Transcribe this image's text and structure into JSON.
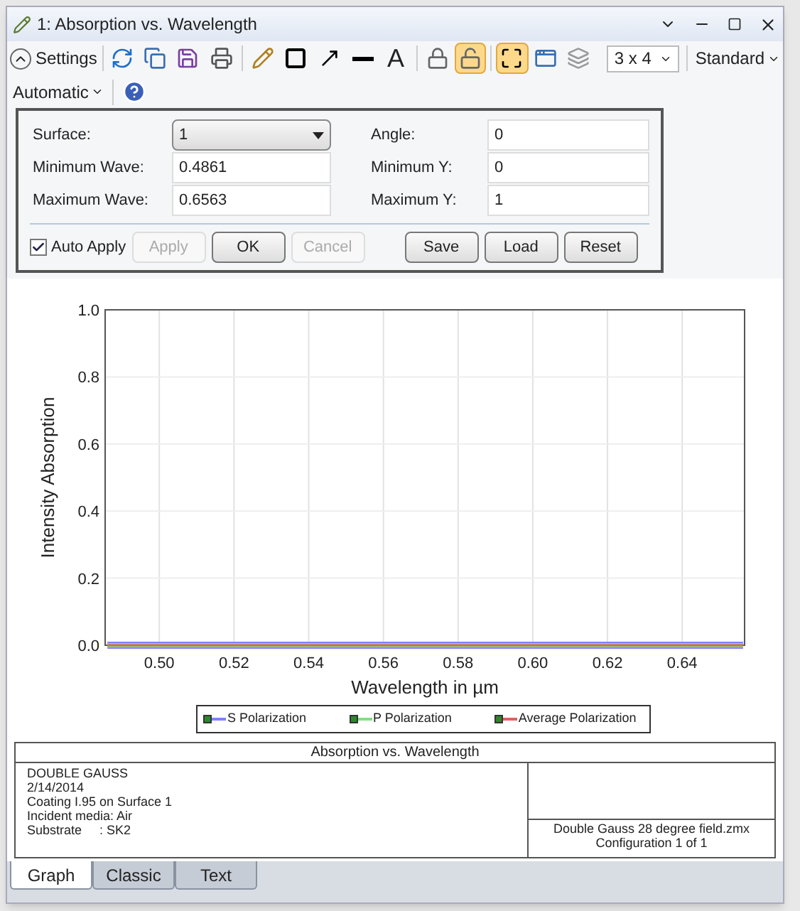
{
  "window": {
    "title": "1: Absorption vs. Wavelength"
  },
  "toolbar": {
    "settings_label": "Settings",
    "settings_expanded": true,
    "tools": [
      {
        "kind": "refresh",
        "selected": false
      },
      {
        "kind": "copy",
        "selected": false
      },
      {
        "kind": "save",
        "selected": false
      },
      {
        "kind": "print",
        "selected": false
      },
      {
        "kind": "pencil",
        "selected": false
      },
      {
        "kind": "rectangle",
        "selected": false
      },
      {
        "kind": "arrow",
        "selected": false
      },
      {
        "kind": "line",
        "selected": false
      },
      {
        "kind": "text",
        "label": "A",
        "selected": false
      },
      {
        "kind": "lock",
        "selected": false
      },
      {
        "kind": "unlock",
        "selected": true
      },
      {
        "kind": "fit",
        "selected": true
      },
      {
        "kind": "windows",
        "selected": false
      },
      {
        "kind": "layers",
        "selected": false
      }
    ],
    "layout_select": "3 x 4",
    "style_menu": "Standard",
    "scale_menu": "Automatic"
  },
  "settings": {
    "fields": [
      {
        "label": "Surface:",
        "value": "1",
        "kind": "dropdown"
      },
      {
        "label": "Angle:",
        "value": "0",
        "kind": "input"
      },
      {
        "label": "Minimum Wave:",
        "value": "0.4861",
        "kind": "input"
      },
      {
        "label": "Minimum Y:",
        "value": "0",
        "kind": "input"
      },
      {
        "label": "Maximum Wave:",
        "value": "0.6563",
        "kind": "input"
      },
      {
        "label": "Maximum Y:",
        "value": "1",
        "kind": "input"
      }
    ],
    "auto_apply": {
      "label": "Auto Apply",
      "checked": true
    },
    "buttons": [
      {
        "label": "Apply",
        "disabled": true
      },
      {
        "label": "OK",
        "disabled": false
      },
      {
        "label": "Cancel",
        "disabled": true
      },
      {
        "label": "Save",
        "disabled": false
      },
      {
        "label": "Load",
        "disabled": false
      },
      {
        "label": "Reset",
        "disabled": false
      }
    ]
  },
  "chart": {
    "chart_data": {
      "type": "line",
      "grid": true,
      "legend": true,
      "xlabel": "Wavelength in µm",
      "ylabel": "Intensity Absorption",
      "x": [
        0.4861,
        0.6563
      ],
      "xlim": [
        0.4855,
        0.6567
      ],
      "ylim": [
        0,
        1
      ],
      "xticks": [
        {
          "value": 0.5,
          "label": "0.50"
        },
        {
          "value": 0.52,
          "label": "0.52"
        },
        {
          "value": 0.54,
          "label": "0.54"
        },
        {
          "value": 0.56,
          "label": "0.56"
        },
        {
          "value": 0.58,
          "label": "0.58"
        },
        {
          "value": 0.6,
          "label": "0.60"
        },
        {
          "value": 0.62,
          "label": "0.62"
        },
        {
          "value": 0.64,
          "label": "0.64"
        }
      ],
      "yticks": [
        {
          "value": 0,
          "label": "0.0"
        },
        {
          "value": 0.2,
          "label": "0.2"
        },
        {
          "value": 0.4,
          "label": "0.4"
        },
        {
          "value": 0.6,
          "label": "0.6"
        },
        {
          "value": 0.8,
          "label": "0.8"
        },
        {
          "value": 1,
          "label": "1.0"
        }
      ],
      "series": [
        {
          "name": "S Polarization",
          "color": "#8080ff",
          "values": [
            0,
            0
          ]
        },
        {
          "name": "P Polarization",
          "color": "#80e080",
          "values": [
            0,
            0
          ]
        },
        {
          "name": "Average Polarization",
          "color": "#e06060",
          "values": [
            0,
            0
          ]
        }
      ]
    }
  },
  "footer": {
    "title": "Absorption vs. Wavelength",
    "left_lines": [
      "DOUBLE GAUSS",
      "2/14/2014",
      "Coating I.95 on Surface 1",
      "Incident media: Air",
      "Substrate     : SK2"
    ],
    "right_lines": [
      "Double Gauss 28 degree field.zmx",
      "Configuration 1 of 1"
    ]
  },
  "tabs": [
    {
      "label": "Graph",
      "selected": true
    },
    {
      "label": "Classic",
      "selected": false
    },
    {
      "label": "Text",
      "selected": false
    }
  ]
}
